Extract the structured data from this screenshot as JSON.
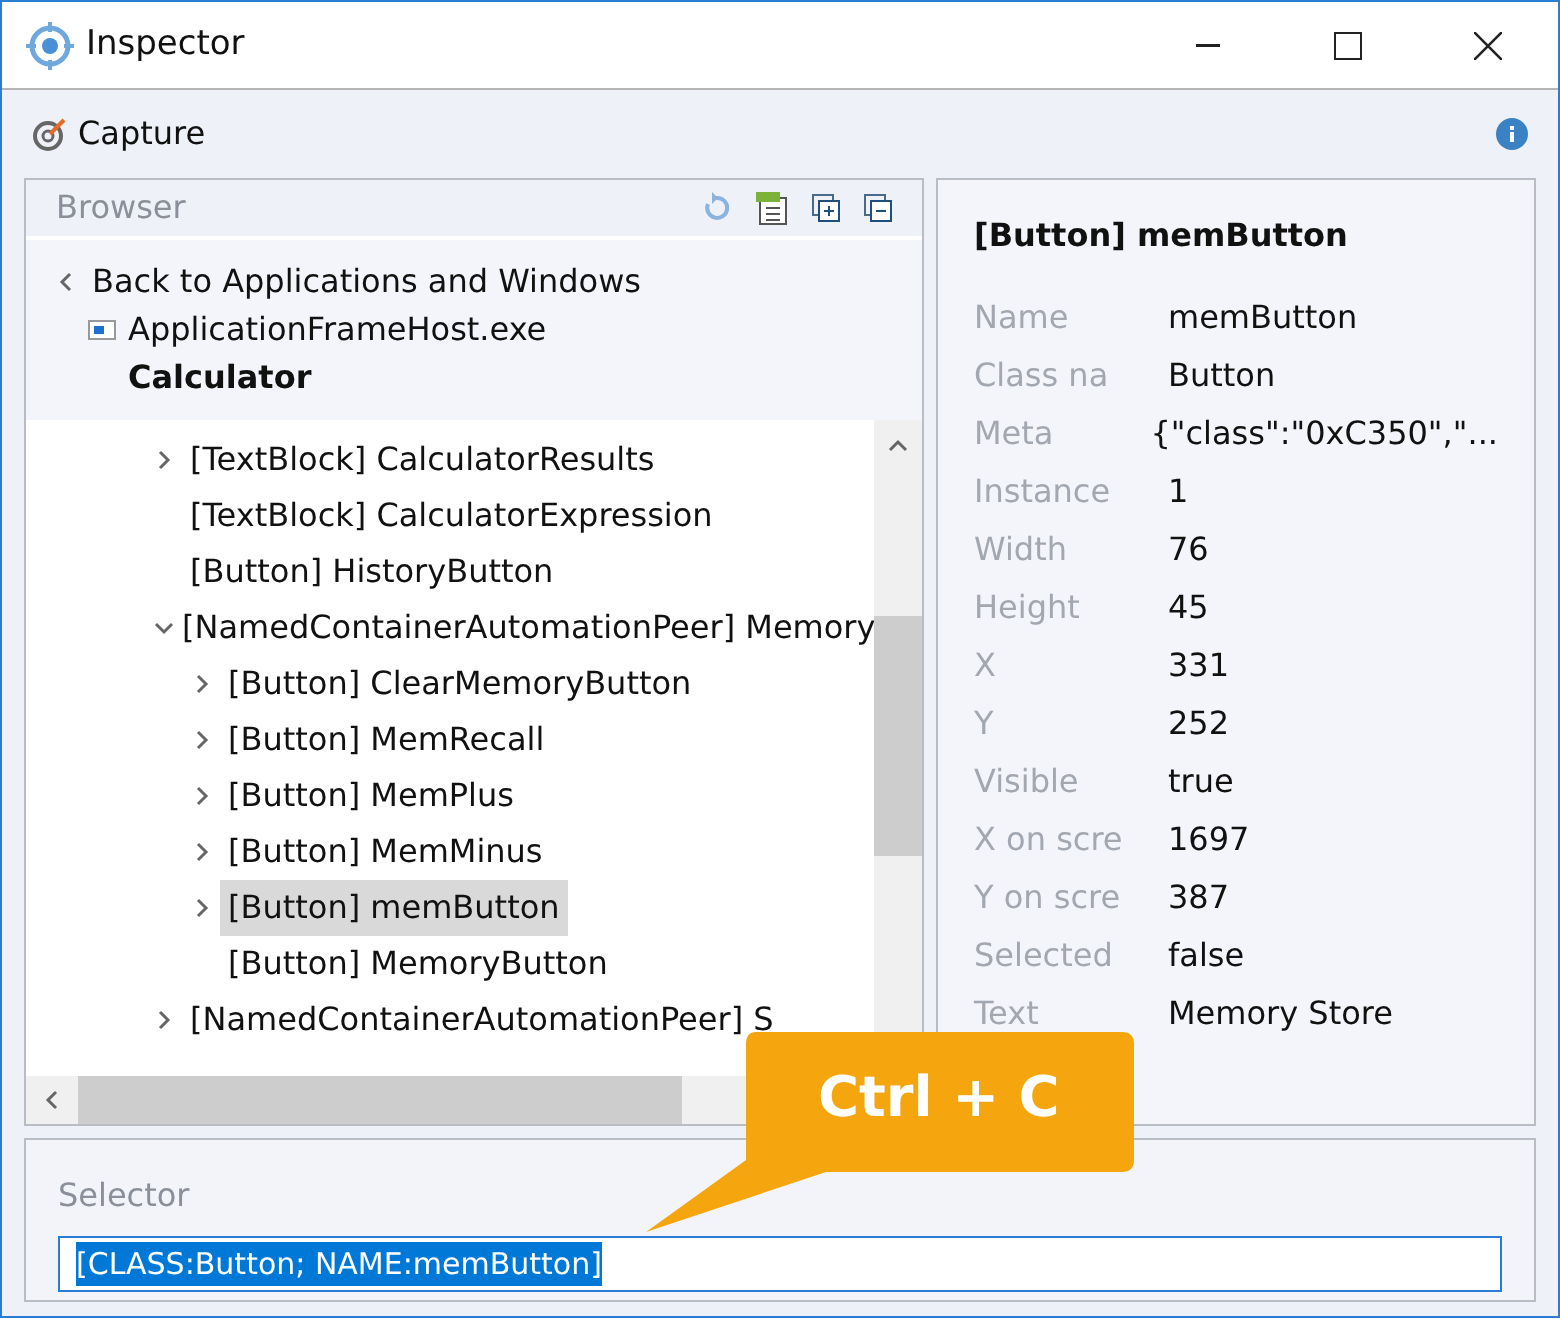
{
  "window": {
    "title": "Inspector"
  },
  "toolbar": {
    "capture": "Capture"
  },
  "browser": {
    "title": "Browser",
    "back": "Back to Applications and Windows",
    "process": "ApplicationFrameHost.exe",
    "app": "Calculator",
    "tree": [
      {
        "label": "[TextBlock] CalculatorResults",
        "kind": "branch",
        "expanded": false,
        "selected": false
      },
      {
        "label": "[TextBlock] CalculatorExpression",
        "kind": "leaf",
        "selected": false
      },
      {
        "label": "[Button] HistoryButton",
        "kind": "leaf",
        "selected": false
      },
      {
        "label": "[NamedContainerAutomationPeer] Memory",
        "kind": "branch",
        "expanded": true,
        "selected": false,
        "children": [
          {
            "label": "[Button] ClearMemoryButton",
            "kind": "branch",
            "expanded": false,
            "selected": false
          },
          {
            "label": "[Button] MemRecall",
            "kind": "branch",
            "expanded": false,
            "selected": false
          },
          {
            "label": "[Button] MemPlus",
            "kind": "branch",
            "expanded": false,
            "selected": false
          },
          {
            "label": "[Button] MemMinus",
            "kind": "branch",
            "expanded": false,
            "selected": false
          },
          {
            "label": "[Button] memButton",
            "kind": "branch",
            "expanded": false,
            "selected": true
          },
          {
            "label": "[Button] MemoryButton",
            "kind": "leaf",
            "selected": false
          }
        ]
      },
      {
        "label": "[NamedContainerAutomationPeer] S",
        "kind": "branch",
        "expanded": false,
        "selected": false
      }
    ]
  },
  "properties": {
    "title": "[Button] memButton",
    "rows": [
      {
        "name": "Name",
        "value": "memButton"
      },
      {
        "name": "Class na",
        "value": "Button"
      },
      {
        "name": "Meta",
        "value": "{\"class\":\"0xC350\",\"..."
      },
      {
        "name": "Instance",
        "value": "1"
      },
      {
        "name": "Width",
        "value": "76"
      },
      {
        "name": "Height",
        "value": "45"
      },
      {
        "name": "X",
        "value": "331"
      },
      {
        "name": "Y",
        "value": "252"
      },
      {
        "name": "Visible",
        "value": "true"
      },
      {
        "name": "X on scre",
        "value": "1697"
      },
      {
        "name": "Y on scre",
        "value": "387"
      },
      {
        "name": "Selected",
        "value": "false"
      },
      {
        "name": "Text",
        "value": "Memory Store"
      }
    ]
  },
  "selector": {
    "label": "Selector",
    "value": "[CLASS:Button; NAME:memButton]"
  },
  "callout": {
    "text": "Ctrl + C"
  }
}
